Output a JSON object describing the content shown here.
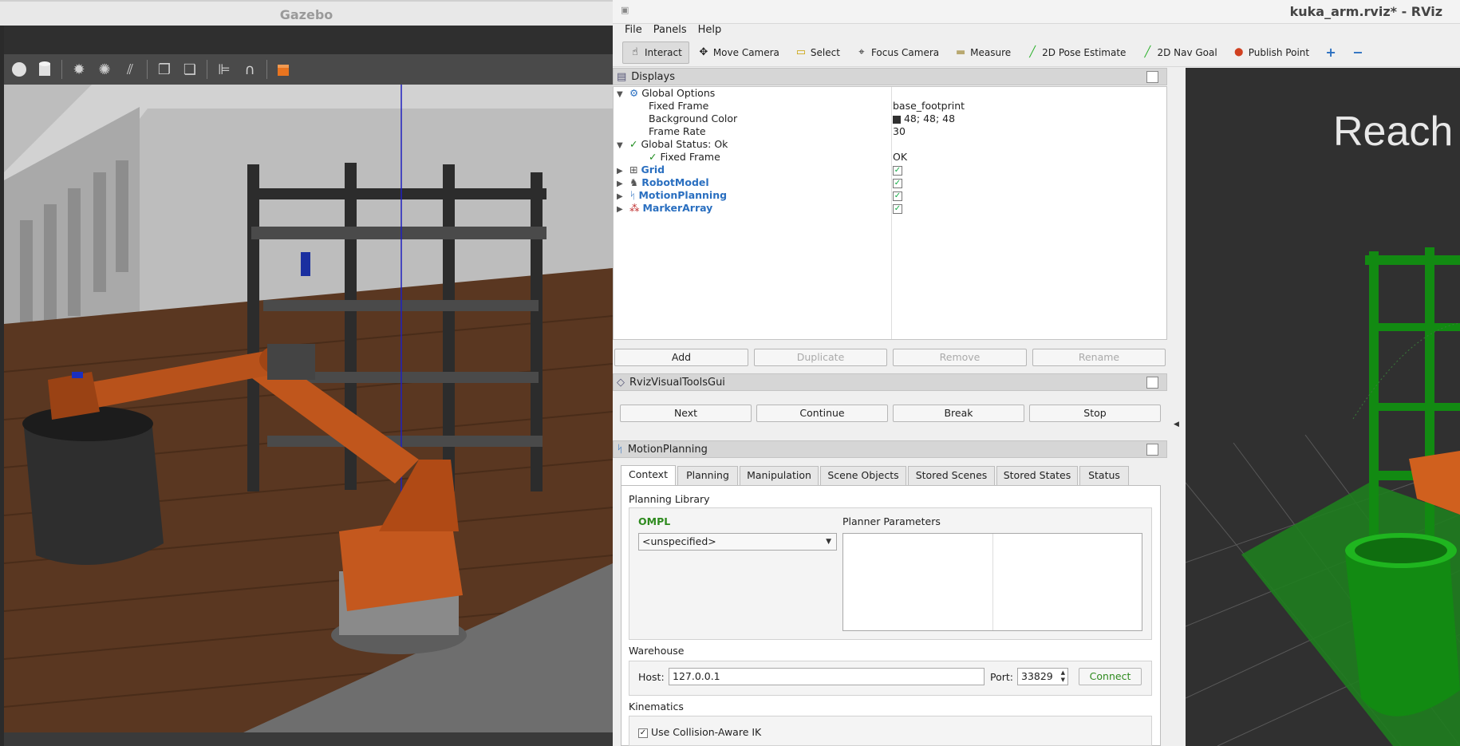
{
  "gazebo": {
    "title": "Gazebo",
    "status_text": "",
    "toolbar_icons": [
      "sphere-icon",
      "cylinder-icon",
      "sun-icon",
      "spot-light-icon",
      "directional-light-icon",
      "copy-icon",
      "paste-icon",
      "align-icon",
      "magnet-icon",
      "orange-box-icon"
    ]
  },
  "rviz": {
    "title": "kuka_arm.rviz* - RViz",
    "menu": [
      "File",
      "Panels",
      "Help"
    ],
    "tools": [
      {
        "label": "Interact",
        "icon": "☝"
      },
      {
        "label": "Move Camera",
        "icon": "✥"
      },
      {
        "label": "Select",
        "icon": "▭"
      },
      {
        "label": "Focus Camera",
        "icon": "⌖"
      },
      {
        "label": "Measure",
        "icon": "▬"
      },
      {
        "label": "2D Pose Estimate",
        "icon": "╱"
      },
      {
        "label": "2D Nav Goal",
        "icon": "╱"
      },
      {
        "label": "Publish Point",
        "icon": "⬤"
      }
    ],
    "displays": {
      "title": "Displays",
      "rows": {
        "global_options": "Global Options",
        "fixed_frame": "Fixed Frame",
        "fixed_frame_val": "base_footprint",
        "background_color": "Background Color",
        "background_color_val": "48; 48; 48",
        "frame_rate": "Frame Rate",
        "frame_rate_val": "30",
        "global_status": "Global Status: Ok",
        "status_fixed_frame": "Fixed Frame",
        "status_fixed_frame_val": "OK",
        "grid": "Grid",
        "robot_model": "RobotModel",
        "motion_planning": "MotionPlanning",
        "marker_array": "MarkerArray"
      },
      "buttons": [
        "Add",
        "Duplicate",
        "Remove",
        "Rename"
      ]
    },
    "visual_tools": {
      "title": "RvizVisualToolsGui",
      "buttons": [
        "Next",
        "Continue",
        "Break",
        "Stop"
      ]
    },
    "motion_planning": {
      "title": "MotionPlanning",
      "tabs": [
        "Context",
        "Planning",
        "Manipulation",
        "Scene Objects",
        "Stored Scenes",
        "Stored States",
        "Status"
      ],
      "planning_library": "Planning Library",
      "ompl": "OMPL",
      "planner_select": "<unspecified>",
      "planner_parameters": "Planner Parameters",
      "warehouse": "Warehouse",
      "host_label": "Host:",
      "host_value": "127.0.0.1",
      "port_label": "Port:",
      "port_value": "33829",
      "connect": "Connect",
      "kinematics": "Kinematics",
      "collision_ik": "Use Collision-Aware IK"
    },
    "viewport_text": "Reach"
  }
}
